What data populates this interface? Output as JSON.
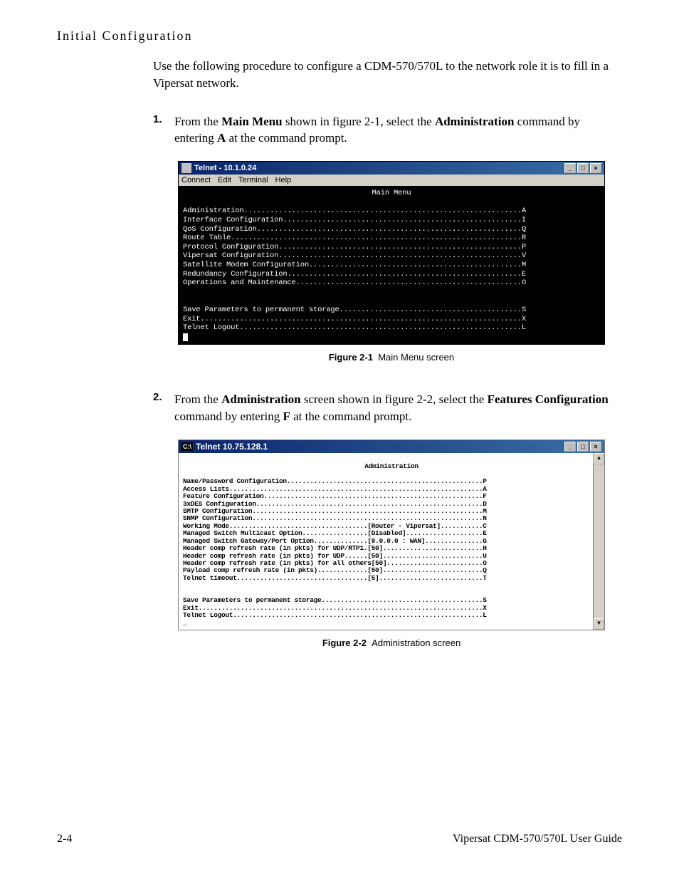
{
  "header": {
    "section_title": "Initial Configuration"
  },
  "intro": {
    "text_part1": "Use the following procedure to configure a CDM-570/570L to the network role it is to fill in a Vipersat network."
  },
  "step1": {
    "num": "1.",
    "text_prefix": "From the ",
    "bold1": "Main Menu",
    "text_mid1": " shown in figure 2-1, select the ",
    "bold2": "Administration",
    "text_mid2": " command by entering ",
    "bold3": "A",
    "text_suffix": " at the command prompt."
  },
  "telnet1": {
    "title": "Telnet - 10.1.0.24",
    "menu_items": [
      "Connect",
      "Edit",
      "Terminal",
      "Help"
    ],
    "heading": "Main Menu",
    "lines": [
      "Administration................................................................A",
      "Interface Configuration.......................................................I",
      "QoS Configuration.............................................................Q",
      "Route Table...................................................................R",
      "Protocol Configuration........................................................P",
      "Vipersat Configuration........................................................V",
      "Satellite Modem Configuration.................................................M",
      "Redundancy Configuration......................................................E",
      "Operations and Maintenance....................................................O",
      "",
      "",
      "Save Parameters to permanent storage..........................................S",
      "Exit..........................................................................X",
      "Telnet Logout.................................................................L"
    ]
  },
  "caption1": {
    "label": "Figure 2-1",
    "text": "Main Menu screen"
  },
  "step2": {
    "num": "2.",
    "text_prefix": "From the ",
    "bold1": "Administration",
    "text_mid1": " screen shown in figure 2-2, select the ",
    "bold2": "Features Configuration",
    "text_mid2": " command by entering ",
    "bold3": "F",
    "text_suffix": " at the command prompt."
  },
  "telnet2": {
    "title": "Telnet 10.75.128.1",
    "heading": "Administration",
    "lines": [
      "Name/Password Configuration...................................................P",
      "Access Lists..................................................................A",
      "Feature Configuration.........................................................F",
      "3xDES Configuration...........................................................D",
      "SMTP Configuration............................................................M",
      "SNMP Configuration............................................................N",
      "Working Mode....................................[Router - Vipersat]...........C",
      "Managed Switch Multicast Option.................[Disabled]....................E",
      "Managed Switch Gateway/Port Option..............[0.0.0.0 : WAN]...............G",
      "Header comp refresh rate (in pkts) for UDP/RTP1.[50]..........................H",
      "Header comp refresh rate (in pkts) for UDP......[50]..........................U",
      "Header comp refresh rate (in pkts) for all others[50].........................O",
      "Payload comp refresh rate (in pkts).............[50]..........................Q",
      "Telnet timeout..................................[5]...........................T",
      "",
      "",
      "Save Parameters to permanent storage..........................................S",
      "Exit..........................................................................X",
      "Telnet Logout.................................................................L"
    ]
  },
  "caption2": {
    "label": "Figure 2-2",
    "text": "Administration screen"
  },
  "footer": {
    "page": "2-4",
    "doc_title": "Vipersat CDM-570/570L User Guide"
  }
}
